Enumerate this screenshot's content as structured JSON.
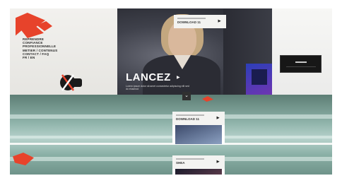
{
  "hero": {
    "title": "LANCEZ",
    "arrow": "▶",
    "caption": "Lorem ipsum dolor sit amet consectetur adipiscing elit sed do eiusmod"
  },
  "cards": [
    {
      "meta": "",
      "label": "DOWNLOAD 11",
      "icon": "▶"
    },
    {
      "meta": "",
      "label": "DOWNLOAD 11",
      "icon": "▶"
    },
    {
      "meta": "",
      "label": "SHEA",
      "icon": "▶"
    }
  ],
  "logo_lines": [
    "REPRENDRE",
    "CONFIANCE",
    "PROFESSIONNELLE",
    "METIER / CONTENUS",
    "CONTACT / FAQ",
    "FR / EN"
  ],
  "scroll_icon": "⌄",
  "colors": {
    "accent": "#e7432b",
    "water": "#8fb3aa",
    "dark": "#171717"
  }
}
